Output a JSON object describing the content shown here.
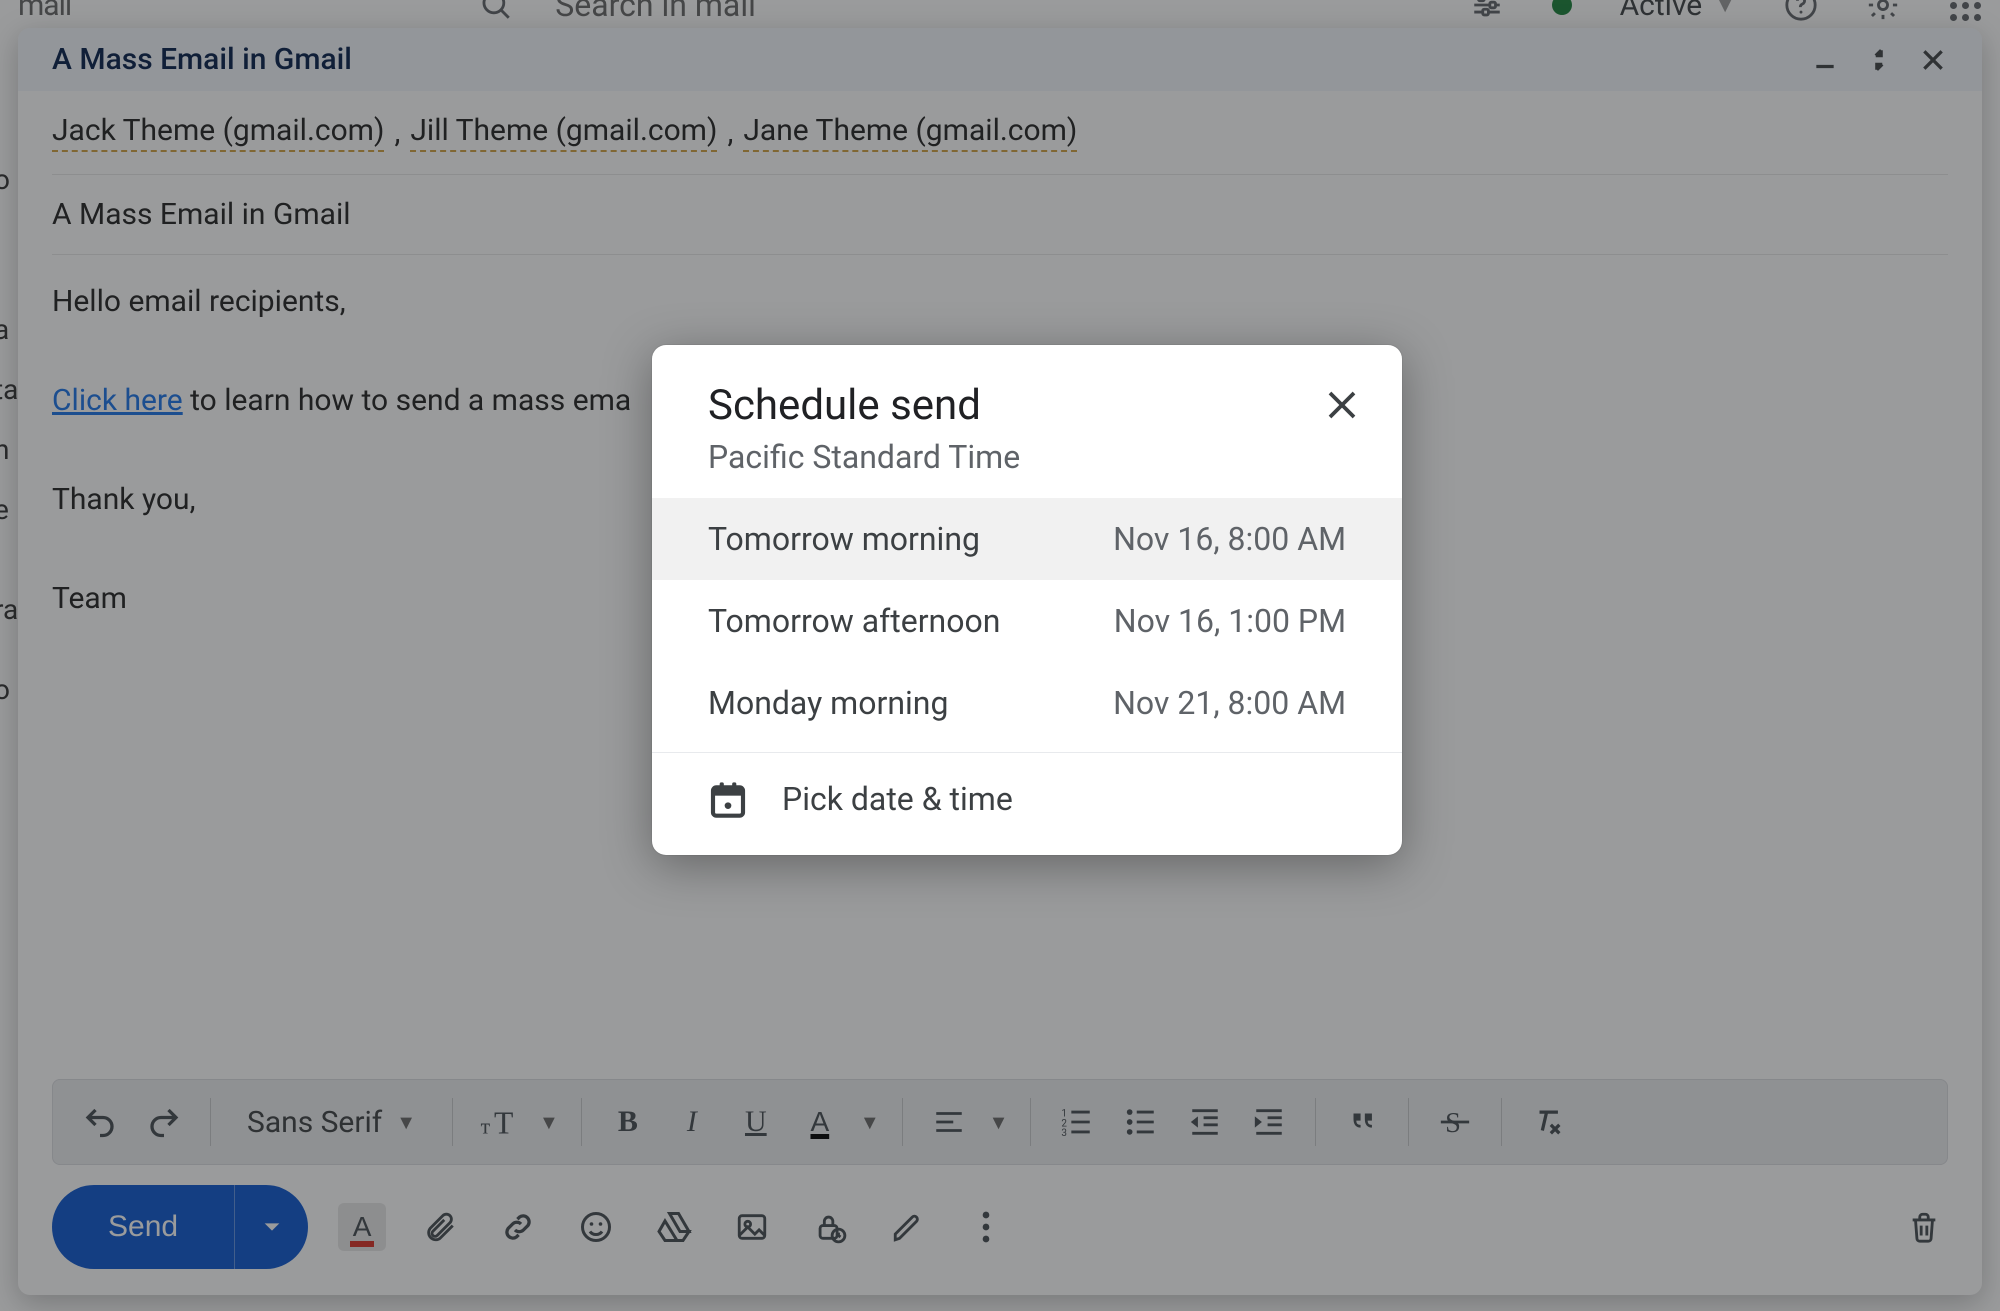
{
  "header": {
    "logo_text": "mail",
    "search_placeholder": "Search in mail",
    "status_label": "Active"
  },
  "sidebar_peek": [
    "o",
    "a",
    "ta",
    "n",
    "e",
    "ra",
    "o"
  ],
  "compose": {
    "title": "A Mass Email in Gmail",
    "recipients": [
      "Jack Theme (gmail.com)",
      "Jill Theme (gmail.com)",
      "Jane Theme (gmail.com)"
    ],
    "recipient_sep": ", ",
    "subject": "A Mass Email in Gmail",
    "body": {
      "line1": "Hello email recipients,",
      "link_text": "Click here",
      "line2_rest": " to learn how to send a mass ema",
      "line3": "Thank you,",
      "line4": "Team"
    }
  },
  "format_toolbar": {
    "font_name": "Sans Serif"
  },
  "send": {
    "label": "Send"
  },
  "dialog": {
    "title": "Schedule send",
    "timezone": "Pacific Standard Time",
    "options": [
      {
        "label": "Tomorrow morning",
        "datetime": "Nov 16, 8:00 AM"
      },
      {
        "label": "Tomorrow afternoon",
        "datetime": "Nov 16, 1:00 PM"
      },
      {
        "label": "Monday morning",
        "datetime": "Nov 21, 8:00 AM"
      }
    ],
    "pick_label": "Pick date & time"
  }
}
